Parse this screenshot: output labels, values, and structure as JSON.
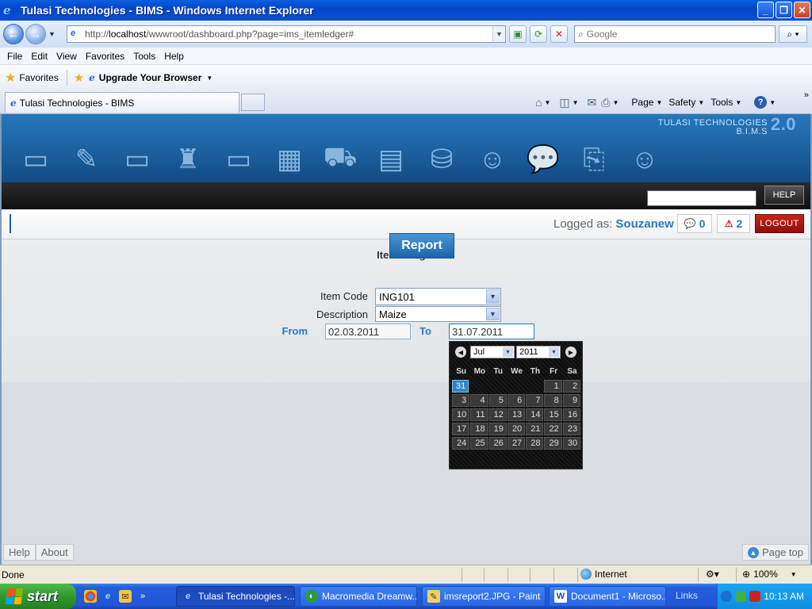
{
  "window": {
    "title": "Tulasi Technologies - BIMS - Windows Internet Explorer",
    "minimize": "_",
    "restore": "❐",
    "close": "✕"
  },
  "addressbar": {
    "url_prefix": "http://",
    "url_host": "localhost",
    "url_path": "/wwwroot/dashboard.php?page=ims_itemledger#",
    "search_placeholder": "Google"
  },
  "menu": [
    "File",
    "Edit",
    "View",
    "Favorites",
    "Tools",
    "Help"
  ],
  "favorites": {
    "label": "Favorites",
    "link": "Upgrade Your Browser"
  },
  "tab": {
    "title": "Tulasi Technologies - BIMS"
  },
  "commands": {
    "page": "Page",
    "safety": "Safety",
    "tools": "Tools"
  },
  "brand": {
    "line1": "TULASI TECHNOLOGIES",
    "line2": "B.I.M.S",
    "version": "2.0"
  },
  "header": {
    "help_button": "HELP",
    "logged_as_label": "Logged as:",
    "username": "Souzanew",
    "messages_count": "0",
    "alerts_count": "2",
    "logout_button": "LOGOUT"
  },
  "form": {
    "title": "Item Ledger",
    "item_code_label": "Item Code",
    "item_code_value": "ING101",
    "description_label": "Description",
    "description_value": "Maize",
    "from_label": "From",
    "from_value": "02.03.2011",
    "to_label": "To",
    "to_value": "31.07.2011",
    "report_button": "Report"
  },
  "calendar": {
    "month": "Jul",
    "year": "2011",
    "weekdays": [
      "Su",
      "Mo",
      "Tu",
      "We",
      "Th",
      "Fr",
      "Sa"
    ],
    "leading_blanks": 5,
    "days_in_month": 31,
    "selected_day": 31
  },
  "footer": {
    "help": "Help",
    "about": "About",
    "page_top": "Page top"
  },
  "status": {
    "text": "Done",
    "zone": "Internet",
    "zoom": "100%"
  },
  "taskbar": {
    "start": "start",
    "tasks": [
      "Tulasi Technologies -...",
      "Macromedia Dreamw...",
      "imsreport2.JPG - Paint",
      "Document1 - Microso..."
    ],
    "links": "Links",
    "clock": "10:13 AM"
  }
}
